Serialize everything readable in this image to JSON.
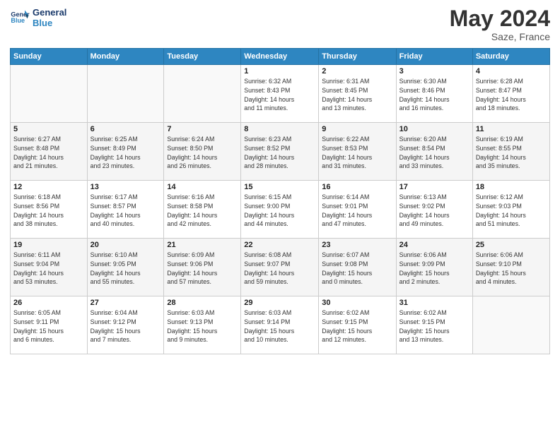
{
  "header": {
    "logo_line1": "General",
    "logo_line2": "Blue",
    "month": "May 2024",
    "location": "Saze, France"
  },
  "weekdays": [
    "Sunday",
    "Monday",
    "Tuesday",
    "Wednesday",
    "Thursday",
    "Friday",
    "Saturday"
  ],
  "weeks": [
    [
      {
        "day": "",
        "info": ""
      },
      {
        "day": "",
        "info": ""
      },
      {
        "day": "",
        "info": ""
      },
      {
        "day": "1",
        "info": "Sunrise: 6:32 AM\nSunset: 8:43 PM\nDaylight: 14 hours\nand 11 minutes."
      },
      {
        "day": "2",
        "info": "Sunrise: 6:31 AM\nSunset: 8:45 PM\nDaylight: 14 hours\nand 13 minutes."
      },
      {
        "day": "3",
        "info": "Sunrise: 6:30 AM\nSunset: 8:46 PM\nDaylight: 14 hours\nand 16 minutes."
      },
      {
        "day": "4",
        "info": "Sunrise: 6:28 AM\nSunset: 8:47 PM\nDaylight: 14 hours\nand 18 minutes."
      }
    ],
    [
      {
        "day": "5",
        "info": "Sunrise: 6:27 AM\nSunset: 8:48 PM\nDaylight: 14 hours\nand 21 minutes."
      },
      {
        "day": "6",
        "info": "Sunrise: 6:25 AM\nSunset: 8:49 PM\nDaylight: 14 hours\nand 23 minutes."
      },
      {
        "day": "7",
        "info": "Sunrise: 6:24 AM\nSunset: 8:50 PM\nDaylight: 14 hours\nand 26 minutes."
      },
      {
        "day": "8",
        "info": "Sunrise: 6:23 AM\nSunset: 8:52 PM\nDaylight: 14 hours\nand 28 minutes."
      },
      {
        "day": "9",
        "info": "Sunrise: 6:22 AM\nSunset: 8:53 PM\nDaylight: 14 hours\nand 31 minutes."
      },
      {
        "day": "10",
        "info": "Sunrise: 6:20 AM\nSunset: 8:54 PM\nDaylight: 14 hours\nand 33 minutes."
      },
      {
        "day": "11",
        "info": "Sunrise: 6:19 AM\nSunset: 8:55 PM\nDaylight: 14 hours\nand 35 minutes."
      }
    ],
    [
      {
        "day": "12",
        "info": "Sunrise: 6:18 AM\nSunset: 8:56 PM\nDaylight: 14 hours\nand 38 minutes."
      },
      {
        "day": "13",
        "info": "Sunrise: 6:17 AM\nSunset: 8:57 PM\nDaylight: 14 hours\nand 40 minutes."
      },
      {
        "day": "14",
        "info": "Sunrise: 6:16 AM\nSunset: 8:58 PM\nDaylight: 14 hours\nand 42 minutes."
      },
      {
        "day": "15",
        "info": "Sunrise: 6:15 AM\nSunset: 9:00 PM\nDaylight: 14 hours\nand 44 minutes."
      },
      {
        "day": "16",
        "info": "Sunrise: 6:14 AM\nSunset: 9:01 PM\nDaylight: 14 hours\nand 47 minutes."
      },
      {
        "day": "17",
        "info": "Sunrise: 6:13 AM\nSunset: 9:02 PM\nDaylight: 14 hours\nand 49 minutes."
      },
      {
        "day": "18",
        "info": "Sunrise: 6:12 AM\nSunset: 9:03 PM\nDaylight: 14 hours\nand 51 minutes."
      }
    ],
    [
      {
        "day": "19",
        "info": "Sunrise: 6:11 AM\nSunset: 9:04 PM\nDaylight: 14 hours\nand 53 minutes."
      },
      {
        "day": "20",
        "info": "Sunrise: 6:10 AM\nSunset: 9:05 PM\nDaylight: 14 hours\nand 55 minutes."
      },
      {
        "day": "21",
        "info": "Sunrise: 6:09 AM\nSunset: 9:06 PM\nDaylight: 14 hours\nand 57 minutes."
      },
      {
        "day": "22",
        "info": "Sunrise: 6:08 AM\nSunset: 9:07 PM\nDaylight: 14 hours\nand 59 minutes."
      },
      {
        "day": "23",
        "info": "Sunrise: 6:07 AM\nSunset: 9:08 PM\nDaylight: 15 hours\nand 0 minutes."
      },
      {
        "day": "24",
        "info": "Sunrise: 6:06 AM\nSunset: 9:09 PM\nDaylight: 15 hours\nand 2 minutes."
      },
      {
        "day": "25",
        "info": "Sunrise: 6:06 AM\nSunset: 9:10 PM\nDaylight: 15 hours\nand 4 minutes."
      }
    ],
    [
      {
        "day": "26",
        "info": "Sunrise: 6:05 AM\nSunset: 9:11 PM\nDaylight: 15 hours\nand 6 minutes."
      },
      {
        "day": "27",
        "info": "Sunrise: 6:04 AM\nSunset: 9:12 PM\nDaylight: 15 hours\nand 7 minutes."
      },
      {
        "day": "28",
        "info": "Sunrise: 6:03 AM\nSunset: 9:13 PM\nDaylight: 15 hours\nand 9 minutes."
      },
      {
        "day": "29",
        "info": "Sunrise: 6:03 AM\nSunset: 9:14 PM\nDaylight: 15 hours\nand 10 minutes."
      },
      {
        "day": "30",
        "info": "Sunrise: 6:02 AM\nSunset: 9:15 PM\nDaylight: 15 hours\nand 12 minutes."
      },
      {
        "day": "31",
        "info": "Sunrise: 6:02 AM\nSunset: 9:15 PM\nDaylight: 15 hours\nand 13 minutes."
      },
      {
        "day": "",
        "info": ""
      }
    ]
  ]
}
